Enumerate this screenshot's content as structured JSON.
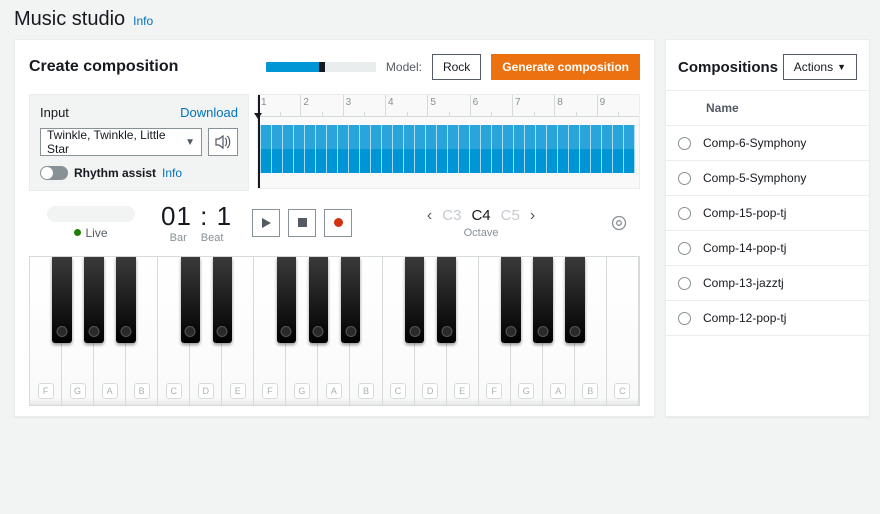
{
  "page": {
    "title": "Music studio",
    "info": "Info"
  },
  "create": {
    "title": "Create composition",
    "model_label": "Model:",
    "model_value": "Rock",
    "generate_label": "Generate composition"
  },
  "input": {
    "label": "Input",
    "download": "Download",
    "selected_song": "Twinkle, Twinkle, Little Star",
    "rhythm_assist": "Rhythm assist",
    "info": "Info"
  },
  "live": {
    "label": "Live"
  },
  "barbeat": {
    "display": "01 : 1",
    "bar_label": "Bar",
    "beat_label": "Beat"
  },
  "ruler": {
    "ticks": [
      "1",
      "2",
      "3",
      "4",
      "5",
      "6",
      "7",
      "8",
      "9"
    ]
  },
  "octave": {
    "prev": "C3",
    "current": "C4",
    "next": "C5",
    "label": "Octave"
  },
  "keyboard": {
    "whites": [
      "F",
      "G",
      "A",
      "B",
      "C",
      "D",
      "E",
      "F",
      "G",
      "A",
      "B",
      "C",
      "D",
      "E",
      "F",
      "G",
      "A",
      "B",
      "C"
    ]
  },
  "compositions": {
    "title": "Compositions",
    "actions_label": "Actions",
    "name_header": "Name",
    "items": [
      {
        "name": "Comp-6-Symphony"
      },
      {
        "name": "Comp-5-Symphony"
      },
      {
        "name": "Comp-15-pop-tj"
      },
      {
        "name": "Comp-14-pop-tj"
      },
      {
        "name": "Comp-13-jazztj"
      },
      {
        "name": "Comp-12-pop-tj"
      }
    ]
  }
}
